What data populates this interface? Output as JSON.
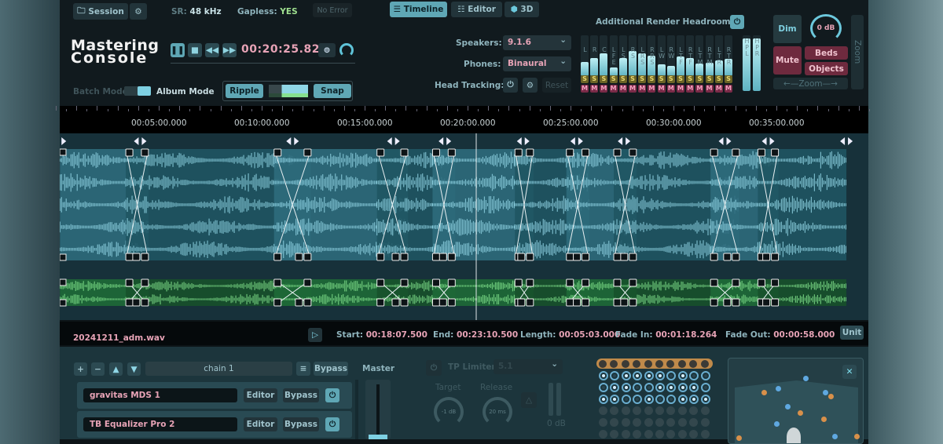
{
  "app": {
    "title_line1": "Mastering",
    "title_line2": "Console"
  },
  "header": {
    "session_label": "Session",
    "sr_label": "SR:",
    "sr_value": "48 kHz",
    "gapless_label": "Gapless:",
    "gapless_value": "YES",
    "error_status": "No Error"
  },
  "views": [
    {
      "label": "Timeline",
      "active": true
    },
    {
      "label": "Editor",
      "active": false
    },
    {
      "label": "3D",
      "active": false
    }
  ],
  "transport": {
    "time": "00:20:25.824"
  },
  "modes": {
    "batch": "Batch Mode",
    "album": "Album Mode",
    "ripple": "Ripple",
    "snap": "Snap"
  },
  "monitoring": {
    "speakers_label": "Speakers:",
    "speakers_value": "9.1.6",
    "phones_label": "Phones:",
    "phones_value": "Binaural",
    "head_tracking_label": "Head Tracking:",
    "reset": "Reset",
    "headroom_label": "Additional Render Headroom:"
  },
  "meters": {
    "channels": [
      {
        "name": "L",
        "level": 0.35
      },
      {
        "name": "R",
        "level": 0.45
      },
      {
        "name": "C",
        "level": 0.55
      },
      {
        "name": "LFE",
        "level": 0.22
      },
      {
        "name": "LS",
        "level": 0.45
      },
      {
        "name": "RS",
        "level": 0.62
      },
      {
        "name": "LRS",
        "level": 0.55
      },
      {
        "name": "RRS",
        "level": 0.5
      },
      {
        "name": "LW",
        "level": 0.28
      },
      {
        "name": "RW",
        "level": 0.25
      },
      {
        "name": "LTF",
        "level": 0.48
      },
      {
        "name": "RTF",
        "level": 0.45
      },
      {
        "name": "LTM",
        "level": 0.3
      },
      {
        "name": "RTM",
        "level": 0.33
      },
      {
        "name": "LTR",
        "level": 0.38
      },
      {
        "name": "RTR",
        "level": 0.42
      },
      {
        "name": "HPL",
        "level": 0.95
      },
      {
        "name": "HPR",
        "level": 0.95
      }
    ],
    "solo": "S",
    "mute": "M"
  },
  "monitor": {
    "dim": "Dim",
    "level": "0 dB",
    "mute": "Mute",
    "beds": "Beds",
    "objects": "Objects",
    "zoom_h": "Zoom",
    "zoom_v": "Zoom"
  },
  "ruler": {
    "ticks": [
      "00:05:00.000",
      "00:10:00.000",
      "00:15:00.000",
      "00:20:00.000",
      "00:25:00.000",
      "00:30:00.000",
      "00:35:00.000"
    ],
    "tick_minutes": [
      5,
      10,
      15,
      20,
      25,
      30,
      35
    ],
    "playhead_minutes": 20.42
  },
  "clips": [
    [
      0.2,
      4.5
    ],
    [
      3.4,
      12.4
    ],
    [
      10.6,
      17.1
    ],
    [
      15.6,
      19.4
    ],
    [
      18.3,
      23.2
    ],
    [
      22.3,
      25.9
    ],
    [
      24.8,
      28.2
    ],
    [
      27.1,
      33.2
    ],
    [
      31.8,
      35.1
    ],
    [
      34.1,
      38.4
    ]
  ],
  "selected_clip": {
    "file": "20241211_adm.wav",
    "start_label": "Start:",
    "start": "00:18:07.500",
    "end_label": "End:",
    "end": "00:23:10.500",
    "length_label": "Length:",
    "length": "00:05:03.000",
    "fade_in_label": "Fade In:",
    "fade_in": "00:01:18.264",
    "fade_out_label": "Fade Out:",
    "fade_out": "00:00:58.000",
    "unit": "Unit"
  },
  "chain": {
    "name": "chain 1",
    "bypass": "Bypass",
    "master": "Master",
    "plugins": [
      {
        "name": "gravitas MDS 1",
        "editor": "Editor",
        "bypass": "Bypass"
      },
      {
        "name": "TB Equalizer Pro 2",
        "editor": "Editor",
        "bypass": "Bypass"
      }
    ]
  },
  "limiter": {
    "label": "TP Limiter",
    "format": "5.1",
    "target_label": "Target",
    "target": "-1 dB",
    "release_label": "Release",
    "release": "20 ms",
    "level": "0 dB"
  }
}
